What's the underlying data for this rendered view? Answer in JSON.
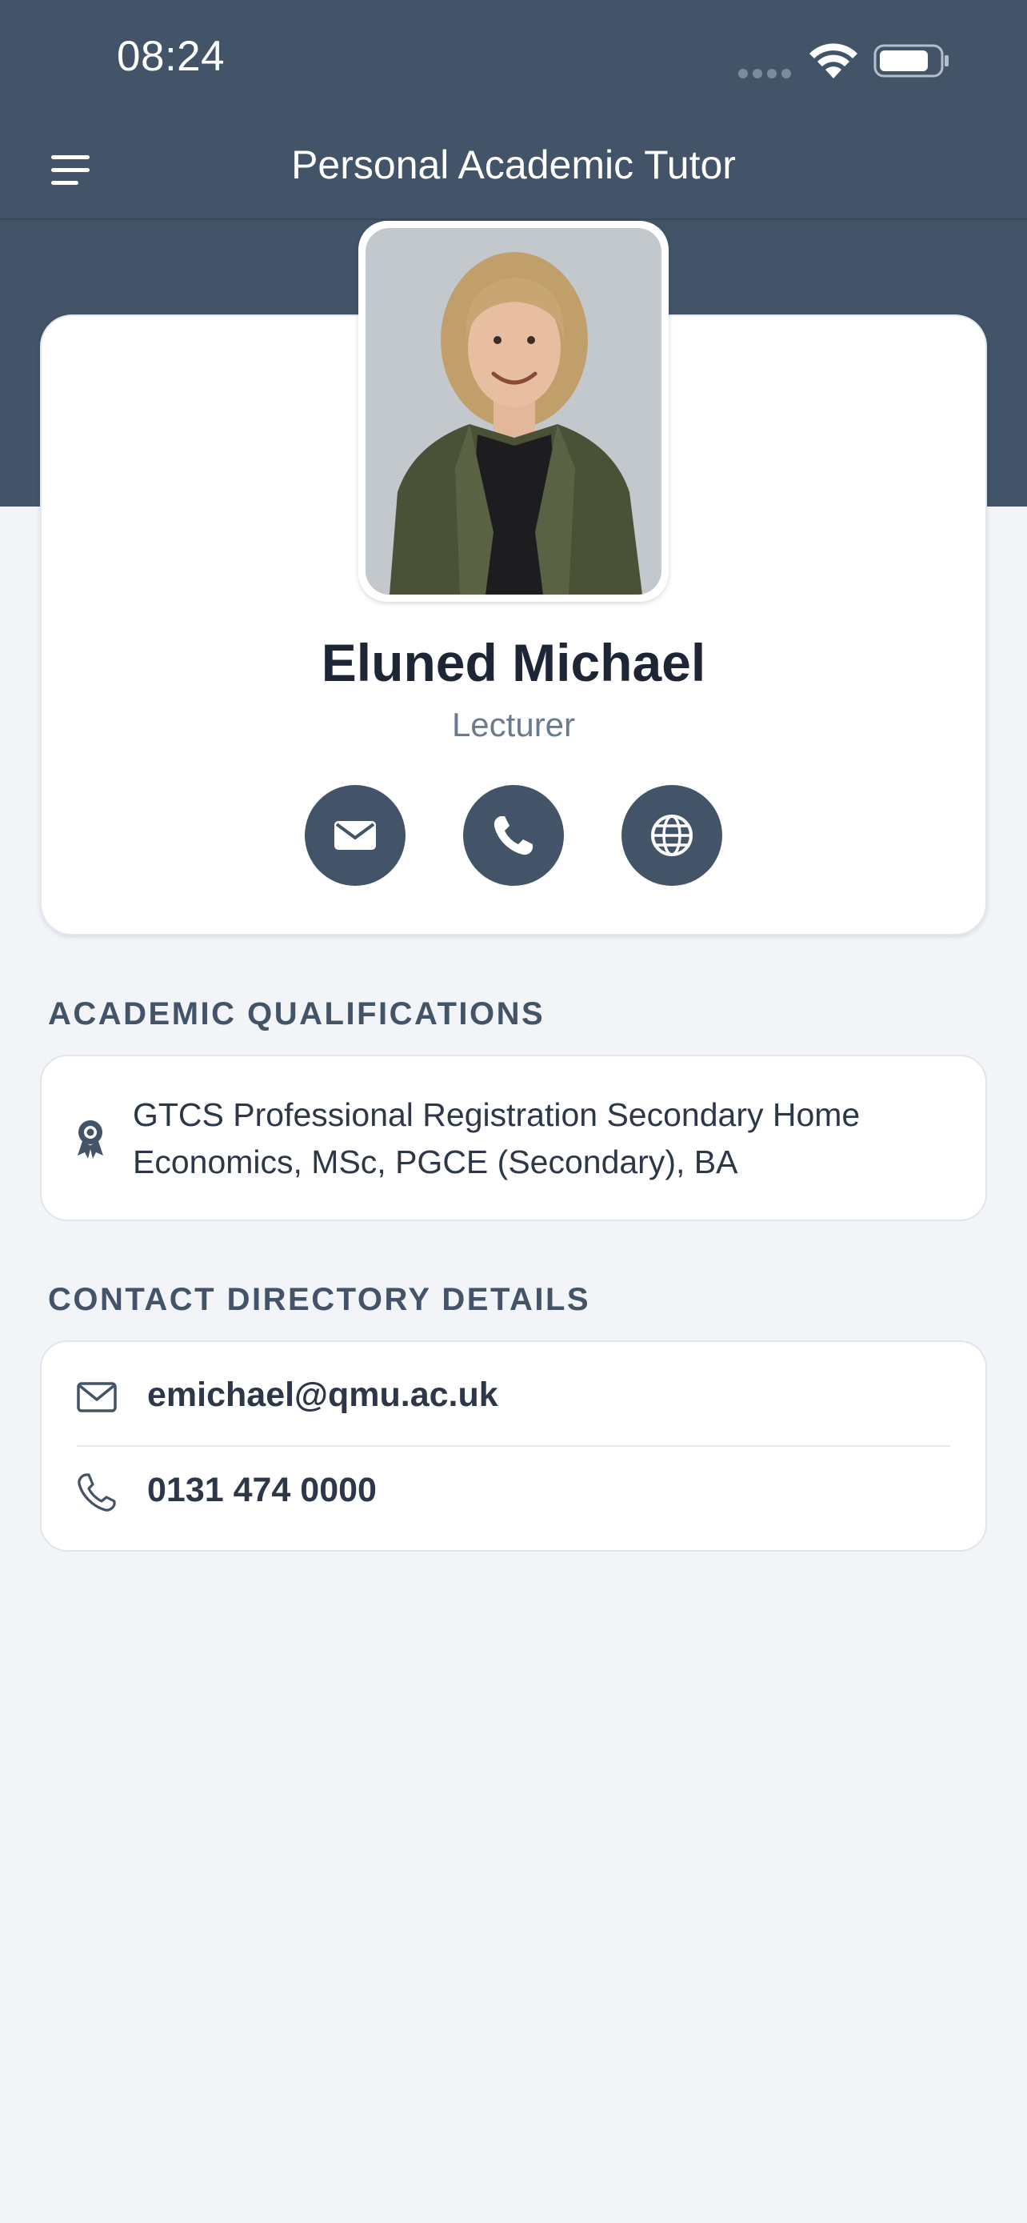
{
  "status_bar": {
    "time": "08:24",
    "signal_icon": "cellular-signal-icon",
    "wifi_icon": "wifi-icon",
    "battery_icon": "battery-icon"
  },
  "nav": {
    "title": "Personal Academic Tutor",
    "menu_icon": "hamburger-menu-icon"
  },
  "profile": {
    "photo_alt": "Eluned Michael",
    "name": "Eluned Michael",
    "role": "Lecturer",
    "actions": [
      {
        "icon": "envelope-icon"
      },
      {
        "icon": "phone-icon"
      },
      {
        "icon": "globe-icon"
      }
    ]
  },
  "qualifications": {
    "heading": "ACADEMIC QUALIFICATIONS",
    "icon": "award-ribbon-icon",
    "text": "GTCS Professional Registration Secondary Home Economics, MSc, PGCE (Secondary), BA"
  },
  "contact": {
    "heading": "CONTACT DIRECTORY DETAILS",
    "email": "emichael@qmu.ac.uk",
    "phone": "0131 474 0000"
  },
  "colors": {
    "header": "#435368",
    "background": "#f2f4f8",
    "card": "#ffffff",
    "action_button": "#435368"
  }
}
